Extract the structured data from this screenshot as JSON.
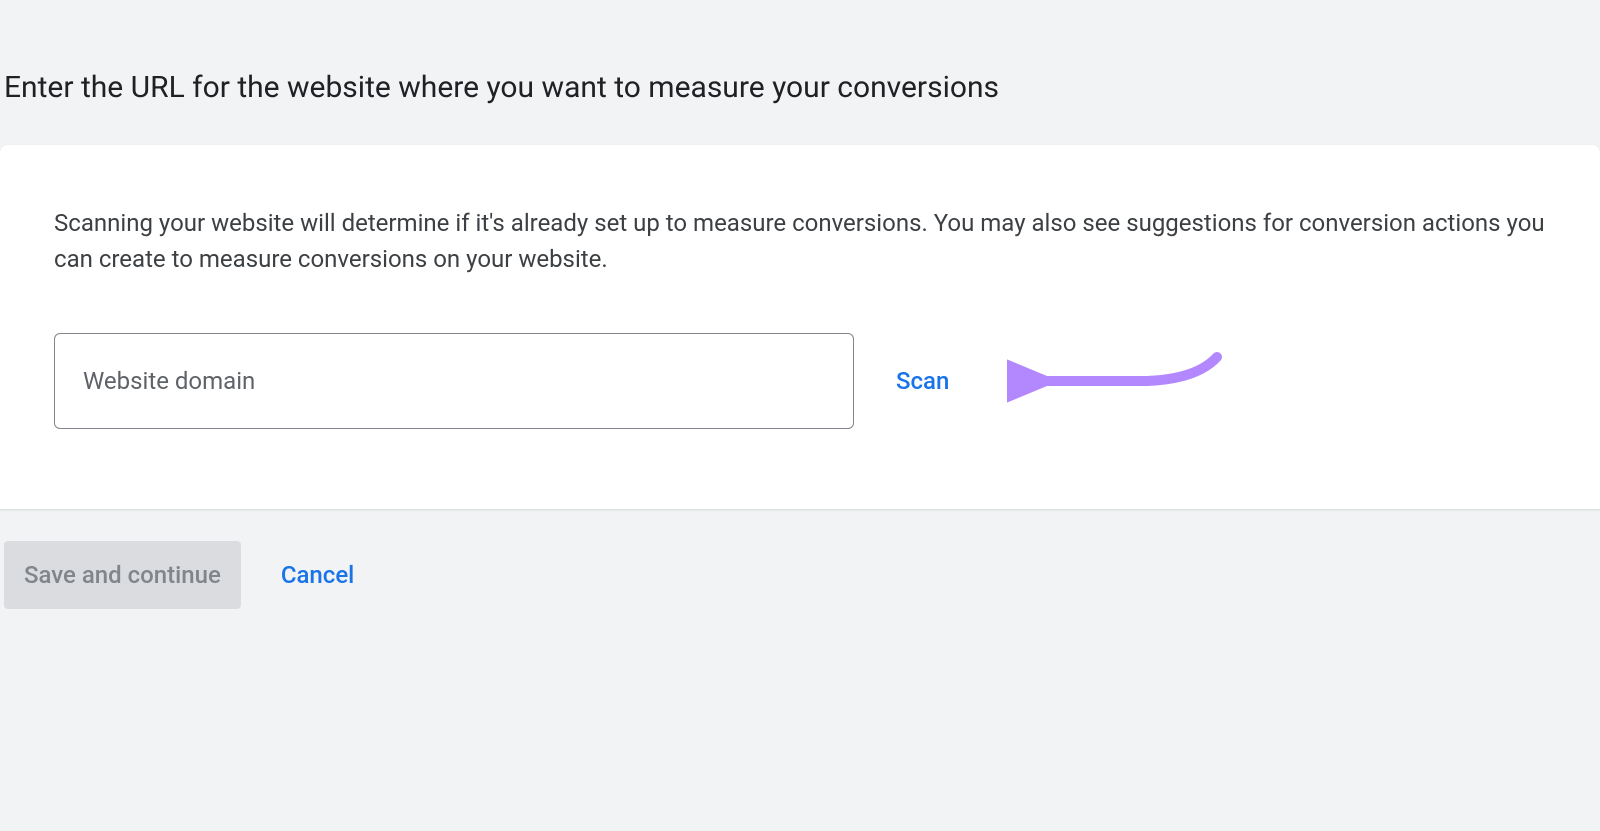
{
  "header": {
    "title": "Enter the URL for the website where you want to measure your conversions"
  },
  "card": {
    "description": "Scanning your website will determine if it's already set up to measure conversions. You may also see suggestions for conversion actions you can create to measure conversions on your website.",
    "domain_input": {
      "placeholder": "Website domain",
      "value": ""
    },
    "scan_label": "Scan"
  },
  "footer": {
    "save_label": "Save and continue",
    "cancel_label": "Cancel"
  },
  "colors": {
    "link_blue": "#1a73e8",
    "annotation_purple": "#b388ff",
    "bg": "#f1f3f4"
  }
}
